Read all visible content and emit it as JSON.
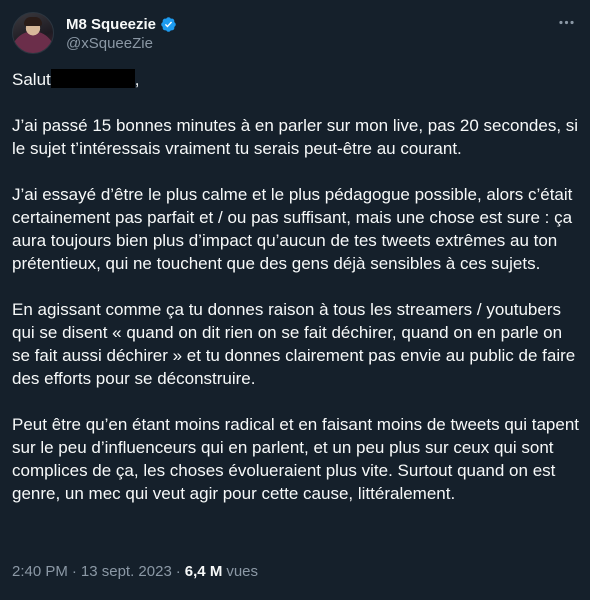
{
  "author": {
    "display_name": "M8 Squeezie",
    "handle": "@xSqueeZie",
    "verified": true,
    "verified_color": "#1d9bf0"
  },
  "tweet": {
    "greeting": "Salut",
    "greeting_suffix": ",",
    "paragraphs": [
      "J’ai passé 15 bonnes minutes à en parler sur mon live, pas 20 secondes, si le sujet t’intéressais vraiment tu serais peut-être au courant.",
      "J’ai essayé d’être le plus calme et le plus pédagogue possible, alors c’était certainement pas parfait et / ou pas suffisant, mais une chose est sure : ça aura toujours bien plus d’impact qu’aucun de tes tweets extrêmes au ton prétentieux, qui ne touchent que des gens déjà sensibles à ces sujets.",
      "En agissant comme ça tu donnes raison à tous les streamers / youtubers qui se disent « quand on dit rien on se fait déchirer, quand on en parle on se fait aussi déchirer » et tu donnes clairement pas envie au public de faire des efforts pour se déconstruire.",
      "Peut être qu’en étant moins radical et en faisant moins de tweets qui tapent sur le peu d’influenceurs qui en parlent, et un peu plus sur ceux qui sont complices de ça, les choses évolueraient plus vite. Surtout quand on est genre, un mec qui veut agir pour cette cause, littéralement."
    ]
  },
  "meta": {
    "time": "2:40 PM",
    "separator": "·",
    "date": "13 sept. 2023",
    "views_count": "6,4 M",
    "views_label": "vues"
  },
  "icons": {
    "verified": "verified-badge-icon",
    "more": "more-options-icon"
  },
  "colors": {
    "background": "#15202b",
    "text": "#f7f9f9",
    "secondary_text": "#8b98a5"
  }
}
